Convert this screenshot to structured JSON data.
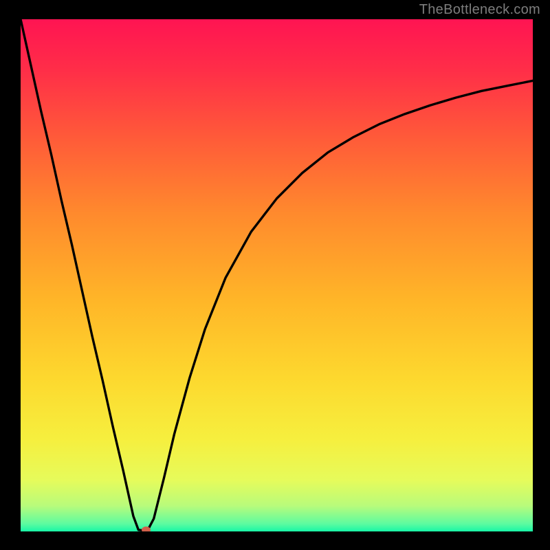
{
  "watermark": "TheBottleneck.com",
  "chart_data": {
    "type": "line",
    "title": "",
    "xlabel": "",
    "ylabel": "",
    "xlim": [
      0,
      100
    ],
    "ylim": [
      0,
      100
    ],
    "grid": false,
    "series": [
      {
        "name": "curve",
        "x": [
          0,
          2,
          4,
          6,
          8,
          10,
          12,
          14,
          16,
          18,
          20,
          21,
          22,
          23,
          24,
          25,
          26,
          28,
          30,
          33,
          36,
          40,
          45,
          50,
          55,
          60,
          65,
          70,
          75,
          80,
          85,
          90,
          95,
          100
        ],
        "y": [
          100,
          91,
          82,
          73.5,
          64.5,
          56,
          47,
          38,
          29.5,
          20.5,
          12,
          7.5,
          3,
          0.3,
          0.2,
          0.6,
          2.5,
          10.5,
          19,
          30,
          39.5,
          49.5,
          58.5,
          65,
          70,
          74,
          77,
          79.5,
          81.5,
          83.2,
          84.7,
          86,
          87,
          88
        ]
      }
    ],
    "gradient_stops": [
      {
        "offset": 0.0,
        "color": "#ff1452"
      },
      {
        "offset": 0.1,
        "color": "#ff2e48"
      },
      {
        "offset": 0.23,
        "color": "#ff5a39"
      },
      {
        "offset": 0.38,
        "color": "#ff8a2d"
      },
      {
        "offset": 0.55,
        "color": "#ffb628"
      },
      {
        "offset": 0.7,
        "color": "#fdd82e"
      },
      {
        "offset": 0.82,
        "color": "#f6ef3e"
      },
      {
        "offset": 0.9,
        "color": "#e6fb5b"
      },
      {
        "offset": 0.95,
        "color": "#b8fb7b"
      },
      {
        "offset": 0.985,
        "color": "#5dfba0"
      },
      {
        "offset": 1.0,
        "color": "#18f7a6"
      }
    ],
    "marker": {
      "x": 24.5,
      "y": 0.3,
      "color": "#d1604b"
    }
  }
}
